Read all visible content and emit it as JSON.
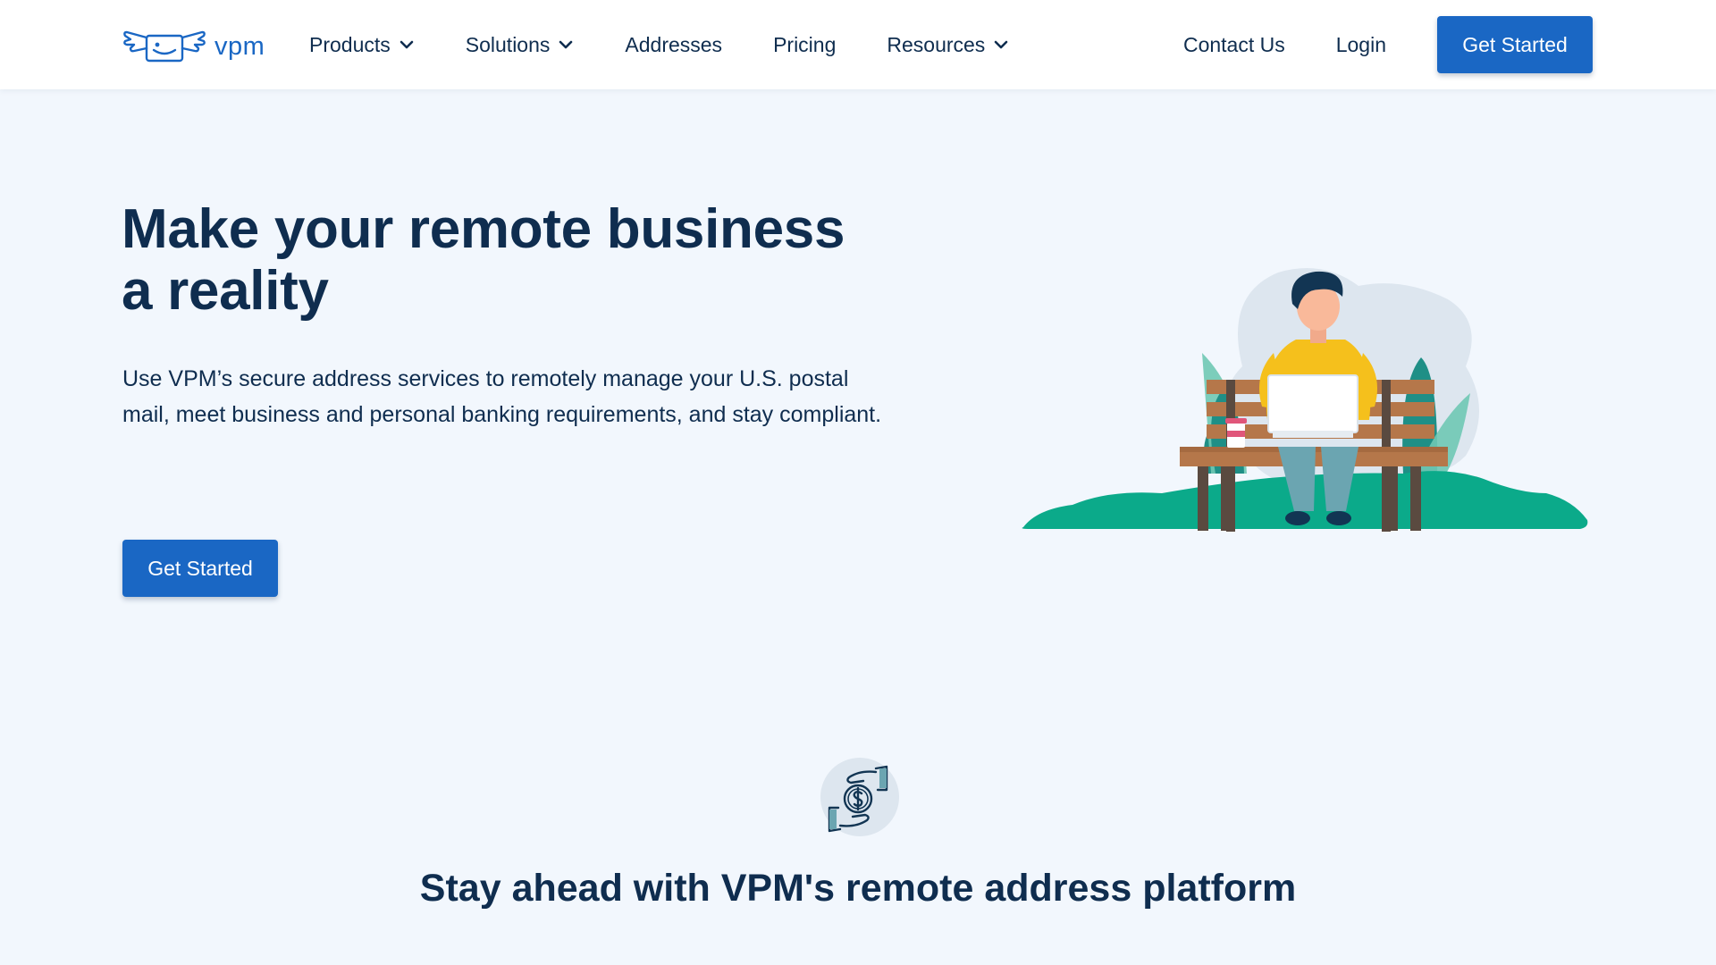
{
  "header": {
    "logo_text": "vpm",
    "nav": [
      {
        "label": "Products",
        "has_dropdown": true
      },
      {
        "label": "Solutions",
        "has_dropdown": true
      },
      {
        "label": "Addresses",
        "has_dropdown": false
      },
      {
        "label": "Pricing",
        "has_dropdown": false
      },
      {
        "label": "Resources",
        "has_dropdown": true
      }
    ],
    "contact_label": "Contact Us",
    "login_label": "Login",
    "cta_label": "Get Started"
  },
  "hero": {
    "title": "Make your remote business a reality",
    "description": "Use VPM’s secure address services to remotely manage your U.S. postal mail, meet business and personal banking requirements, and stay compliant.",
    "cta_label": "Get Started",
    "illustration": "person-on-bench-with-laptop-illustration"
  },
  "features": {
    "icon": "hands-dollar-icon",
    "title": "Stay ahead with VPM's remote address platform"
  },
  "colors": {
    "primary": "#1a67c4",
    "text": "#0f2d4f",
    "background": "#f2f7fd",
    "header_bg": "#ffffff",
    "green": "#0baa8a",
    "teal": "#1f8f86",
    "shirt": "#f5c01c",
    "bench": "#b5774a"
  }
}
